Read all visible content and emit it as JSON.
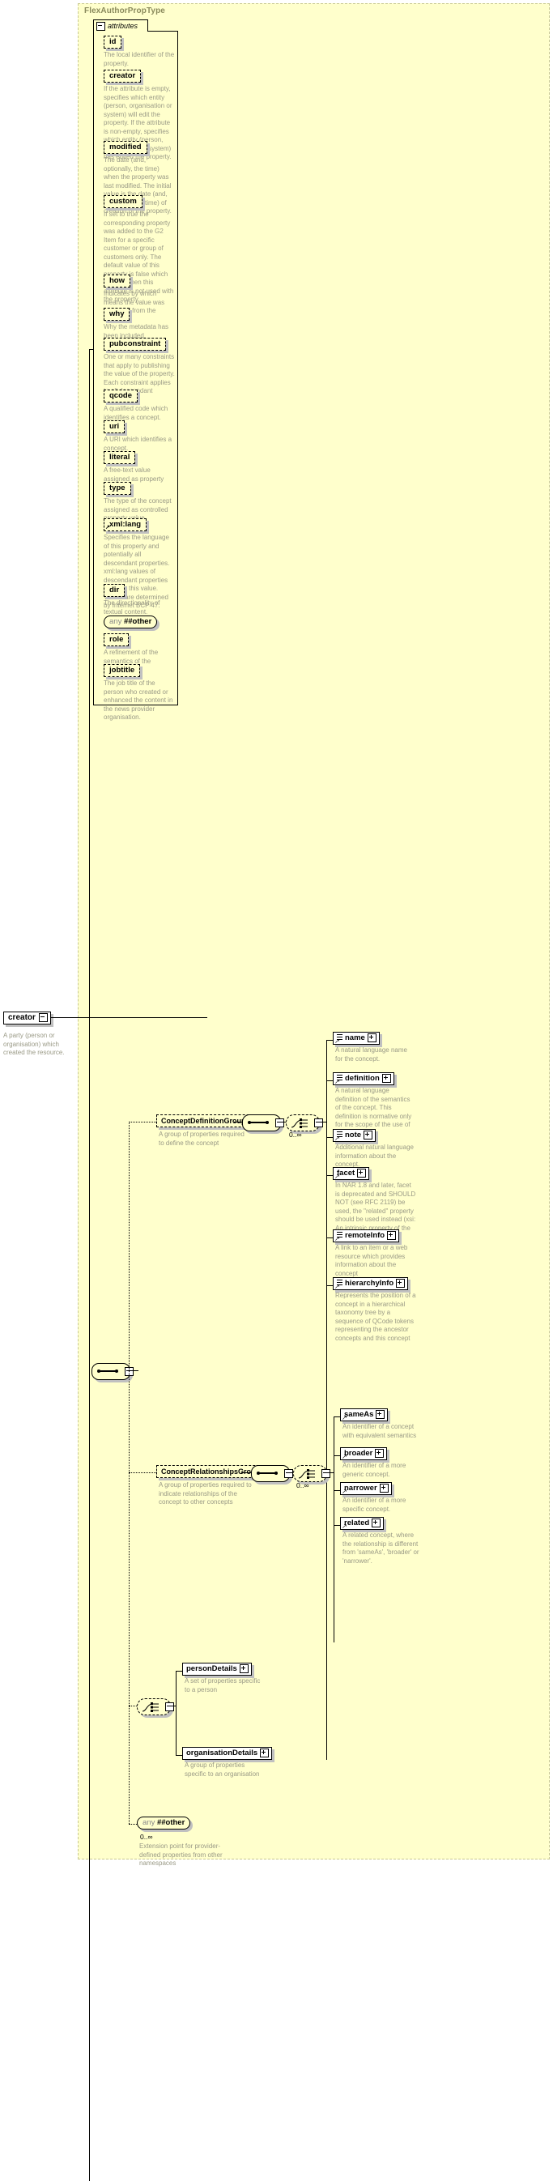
{
  "diagram": {
    "type": "xml-schema",
    "complex_type_title": "FlexAuthorPropType",
    "attributes_label": "attributes",
    "root_element": {
      "name": "creator",
      "description": "A party (person or organisation) which created the resource."
    },
    "attributes": [
      {
        "name": "id",
        "description": "The local identifier of the property."
      },
      {
        "name": "creator",
        "description": "If the attribute is empty, specifies which entity (person, organisation or system) will edit the property. If the attribute is non-empty, specifies which entity (person, organisation or system) has edited the property."
      },
      {
        "name": "modified",
        "description": "The date (and, optionally, the time) when the property was last modified. The initial value is the date (and, optionally, the time) of creation of the property."
      },
      {
        "name": "custom",
        "description": "If set to true the corresponding property was added to the G2 Item for a specific customer or group of customers only. The default value of this property is false which applies when this attribute is not used with the property."
      },
      {
        "name": "how",
        "description": "Indicates by which means the value was extracted from the content."
      },
      {
        "name": "why",
        "description": "Why the metadata has been included."
      },
      {
        "name": "pubconstraint",
        "description": "One or many constraints that apply to publishing the value of the property. Each constraint applies to all descendant elements."
      },
      {
        "name": "qcode",
        "description": "A qualified code which identifies a concept."
      },
      {
        "name": "uri",
        "description": "A URI which identifies a concept."
      },
      {
        "name": "literal",
        "description": "A free-text value assigned as property value."
      },
      {
        "name": "type",
        "description": "The type of the concept assigned as controlled property value."
      },
      {
        "name": "xml:lang",
        "description": "Specifies the language of this property and potentially all descendant properties. xml:lang values of descendant properties override this value. Values are determined by Internet BCP 47."
      },
      {
        "name": "dir",
        "description": "The directionality of textual content."
      },
      {
        "name": "any ##other",
        "description": ""
      },
      {
        "name": "role",
        "description": "A refinement of the semantics of the property."
      },
      {
        "name": "jobtitle",
        "description": "The job title of the person who created or enhanced the content in the news provider organisation."
      }
    ],
    "groups": [
      {
        "name": "ConceptDefinitionGroup",
        "description": "A group of properties required to define the concept",
        "occurrence": "0..∞",
        "children": [
          {
            "name": "name",
            "description": "A natural language name for the concept."
          },
          {
            "name": "definition",
            "description": "A natural language definition of the semantics of the concept. This definition is normative only for the scope of the use of this concept."
          },
          {
            "name": "note",
            "description": "Additional natural language information about the concept."
          },
          {
            "name": "facet",
            "description": "In NAR 1.8 and later, facet is deprecated and SHOULD NOT (see RFC 2119) be used, the \"related\" property should be used instead (xsi: An intrinsic property of the concept.)"
          },
          {
            "name": "remoteInfo",
            "description": "A link to an item or a web resource which provides information about the concept"
          },
          {
            "name": "hierarchyInfo",
            "description": "Represents the position of a concept in a hierarchical taxonomy tree by a sequence of QCode tokens representing the ancestor concepts and this concept"
          }
        ]
      },
      {
        "name": "ConceptRelationshipsGroup",
        "description": "A group of properties required to indicate relationships of the concept to other concepts",
        "occurrence": "0..∞",
        "children": [
          {
            "name": "sameAs",
            "description": "An identifier of a concept with equivalent semantics"
          },
          {
            "name": "broader",
            "description": "An identifier of a more generic concept."
          },
          {
            "name": "narrower",
            "description": "An identifier of a more specific concept."
          },
          {
            "name": "related",
            "description": "A related concept, where the relationship is different from 'sameAs', 'broader' or 'narrower'."
          }
        ]
      }
    ],
    "detail_elements": [
      {
        "name": "personDetails",
        "description": "A set of properties specific to a person"
      },
      {
        "name": "organisationDetails",
        "description": "A group of properties specific to an organisation"
      }
    ],
    "any_other": {
      "label_prefix": "any",
      "label_main": "##other",
      "occurrence": "0..∞",
      "description": "Extension point for provider-defined properties from other namespaces"
    },
    "colors": {
      "type_background": "#ffffcc",
      "description_text": "#9a9a86",
      "title_text": "#8a8a5c",
      "shadow": "#c0c0c0",
      "border": "#000000"
    }
  }
}
